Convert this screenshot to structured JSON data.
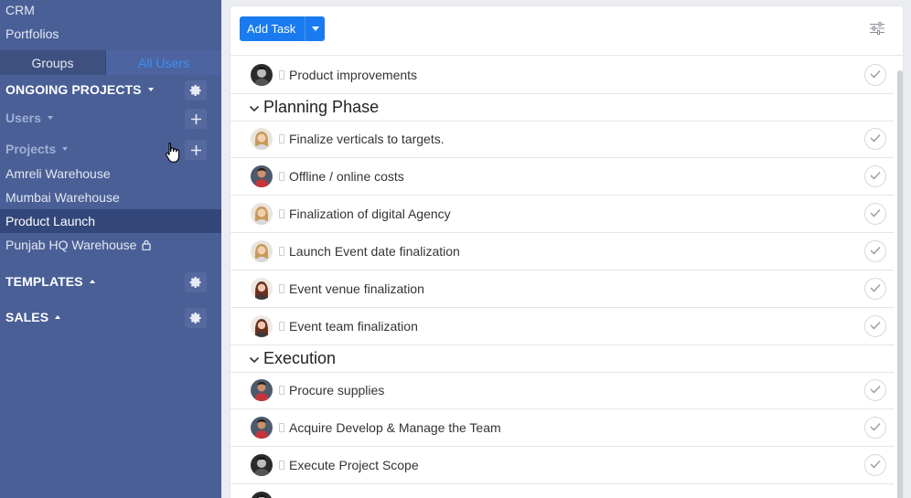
{
  "sidebar": {
    "links": [
      "CRM",
      "Portfolios"
    ],
    "tabs": {
      "groups": "Groups",
      "all_users": "All Users"
    },
    "ongoing_projects": "ONGOING PROJECTS",
    "users": "Users",
    "projects": "Projects",
    "project_items": [
      "Amreli Warehouse",
      "Mumbai Warehouse",
      "Product Launch",
      "Punjab HQ Warehouse"
    ],
    "templates": "TEMPLATES",
    "sales": "SALES",
    "active_project": "Product Launch"
  },
  "toolbar": {
    "add_task_label": "Add Task"
  },
  "tasks": {
    "top": {
      "name": "Product improvements",
      "avatar": "bw"
    },
    "planning": {
      "title": "Planning Phase",
      "items": [
        {
          "name": "Finalize verticals to targets.",
          "avatar": "blonde"
        },
        {
          "name": "Offline / online costs",
          "avatar": "man-red"
        },
        {
          "name": "Finalization of digital Agency",
          "avatar": "blonde"
        },
        {
          "name": "Launch Event date finalization",
          "avatar": "blonde"
        },
        {
          "name": "Event venue finalization",
          "avatar": "brunette"
        },
        {
          "name": "Event team finalization",
          "avatar": "brunette"
        }
      ]
    },
    "execution": {
      "title": "Execution",
      "items": [
        {
          "name": "Procure supplies",
          "avatar": "man-red"
        },
        {
          "name": " Acquire Develop & Manage the Team",
          "avatar": "man-red"
        },
        {
          "name": "Execute Project Scope",
          "avatar": "bw"
        }
      ]
    }
  },
  "colors": {
    "sidebar_bg": "#4a5f96",
    "active_item": "#34477a",
    "accent": "#1a7bf0",
    "tab_active_text": "#3b8ff5"
  }
}
